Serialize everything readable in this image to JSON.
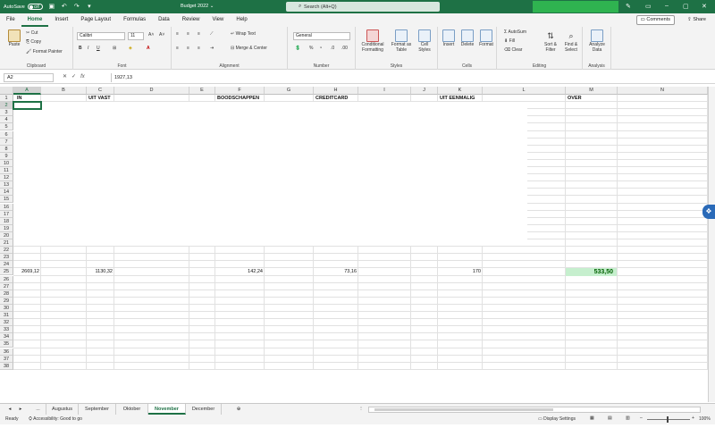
{
  "titlebar": {
    "autosave_label": "AutoSave",
    "autosave_state": "Off",
    "doc_title": "Budget 2022",
    "search_placeholder": "Search (Alt+Q)"
  },
  "menu": {
    "tabs": [
      "File",
      "Home",
      "Insert",
      "Page Layout",
      "Formulas",
      "Data",
      "Review",
      "View",
      "Help"
    ],
    "active": "Home",
    "comments": "Comments",
    "share": "Share"
  },
  "ribbon": {
    "clipboard": {
      "label": "Clipboard",
      "paste": "Paste",
      "cut": "Cut",
      "copy": "Copy",
      "format_painter": "Format Painter"
    },
    "font": {
      "label": "Font",
      "name": "Calibri",
      "size": "11"
    },
    "alignment": {
      "label": "Alignment",
      "wrap": "Wrap Text",
      "merge": "Merge & Center"
    },
    "number": {
      "label": "Number",
      "format": "General"
    },
    "styles": {
      "label": "Styles",
      "conditional": "Conditional Formatting",
      "format_table": "Format as Table",
      "cell_styles": "Cell Styles"
    },
    "cells": {
      "label": "Cells",
      "insert": "Insert",
      "delete": "Delete",
      "format": "Format"
    },
    "editing": {
      "label": "Editing",
      "autosum": "AutoSum",
      "fill": "Fill",
      "clear": "Clear",
      "sort": "Sort & Filter",
      "find": "Find & Select"
    },
    "analysis": {
      "label": "Analysis",
      "analyze": "Analyze Data"
    }
  },
  "formula_bar": {
    "name_box": "A2",
    "formula": "1927,13"
  },
  "grid": {
    "columns": [
      "A",
      "B",
      "C",
      "D",
      "E",
      "F",
      "G",
      "H",
      "I",
      "J",
      "K",
      "L",
      "M",
      "N"
    ],
    "rows": [
      "1",
      "2",
      "3",
      "4",
      "5",
      "6",
      "7",
      "8",
      "9",
      "10",
      "11",
      "12",
      "13",
      "14",
      "15",
      "16",
      "17",
      "18",
      "19",
      "20",
      "21",
      "22",
      "23",
      "24",
      "25",
      "26",
      "27",
      "28",
      "29",
      "30",
      "31",
      "32",
      "33",
      "34",
      "35",
      "36",
      "37",
      "38"
    ],
    "headers": {
      "a1": "IN",
      "c1": "UIT VAST",
      "f1": "BOODSCHAPPEN",
      "h1": "CREDITCARD",
      "k1": "UIT EENMALIG",
      "m1": "OVER"
    },
    "row25": {
      "a": "2669,12",
      "c": "1130,32",
      "f": "142,24",
      "h": "73,16",
      "k": "170",
      "m": "533,50"
    }
  },
  "sheets": {
    "tabs": [
      "...",
      "Augustus",
      "September",
      "Oktober",
      "November",
      "December"
    ],
    "active": "November"
  },
  "status": {
    "ready": "Ready",
    "accessibility": "Accessibility: Good to go",
    "display_settings": "Display Settings",
    "zoom": "100%"
  }
}
